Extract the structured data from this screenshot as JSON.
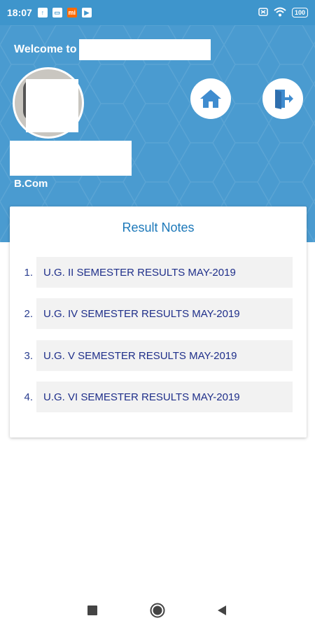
{
  "status_bar": {
    "time": "18:07",
    "notification_icons": [
      "upload-icon",
      "screen-icon",
      "mi-icon",
      "youtube-icon"
    ],
    "battery": "100"
  },
  "header": {
    "welcome_text": "Welcome to",
    "course": "B.Com"
  },
  "result_notes": {
    "title": "Result Notes",
    "items": [
      {
        "number": "1.",
        "label": "U.G. II SEMESTER RESULTS MAY-2019"
      },
      {
        "number": "2.",
        "label": "U.G. IV SEMESTER RESULTS MAY-2019"
      },
      {
        "number": "3.",
        "label": "U.G. V SEMESTER RESULTS MAY-2019"
      },
      {
        "number": "4.",
        "label": "U.G. VI SEMESTER RESULTS MAY-2019"
      }
    ]
  },
  "colors": {
    "header_blue": "#4a9bd0",
    "title_blue": "#1c78b9",
    "item_text": "#1f2f8a"
  }
}
